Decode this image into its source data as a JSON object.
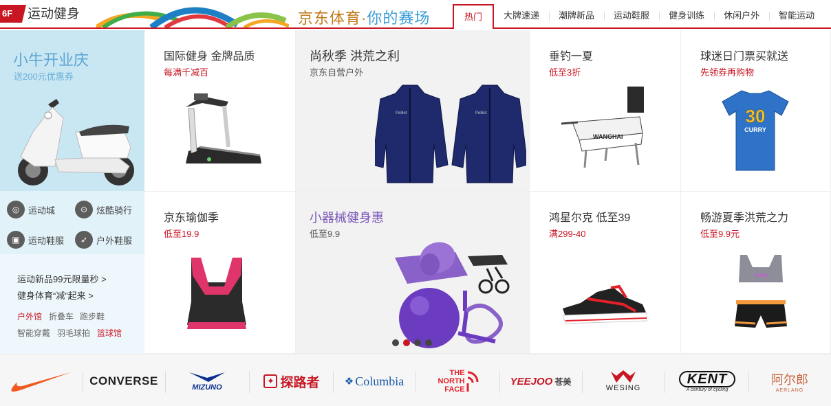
{
  "header": {
    "floor": "6F",
    "title": "运动健身",
    "slogan_a": "京东体育",
    "slogan_dot": "·",
    "slogan_b": "你的赛场",
    "tabs": [
      "热门",
      "大牌速递",
      "潮牌新品",
      "运动鞋服",
      "健身训练",
      "休闲户外",
      "智能运动"
    ],
    "active_tab": 0
  },
  "left": {
    "banner_title": "小牛开业庆",
    "banner_sub": "送200元优惠券",
    "cats": [
      "运动城",
      "炫酷骑行",
      "运动鞋服",
      "户外鞋服"
    ],
    "links": [
      "运动新品99元限量秒 >",
      "健身体育“减”起来 >"
    ],
    "small_links": [
      "户外馆",
      "折叠车",
      "跑步鞋",
      "智能穿戴",
      "羽毛球拍",
      "篮球馆"
    ]
  },
  "cards": [
    {
      "title": "国际健身 金牌品质",
      "sub": "每满千减百"
    },
    {
      "title": "尚秋季 洪荒之利",
      "sub": "京东自营户外"
    },
    {
      "title": "垂钓一夏",
      "sub": "低至3折"
    },
    {
      "title": "球迷日门票买就送",
      "sub": "先领券再购物"
    },
    {
      "title": "京东瑜伽季",
      "sub": "低至19.9"
    },
    {
      "title": "小器械健身惠",
      "sub": "低至9.9"
    },
    {
      "title": "鸿星尔克 低至39",
      "sub": "满299-40"
    },
    {
      "title": "畅游夏季洪荒之力",
      "sub": "低至9.9元"
    }
  ],
  "products": {
    "chair_brand": "WANGHAI",
    "shirt_number": "30",
    "shirt_name": "CURRY",
    "bra_brand": "SANQI",
    "jacket_badge": "Pelliot"
  },
  "carousel": {
    "count": 4,
    "active": 1
  },
  "brands": {
    "converse": "CONVERSE",
    "mizuno": "MIZUNO",
    "toread": "探路者",
    "columbia": "Columbia",
    "tnf_1": "THE",
    "tnf_2": "NORTH",
    "tnf_3": "FACE",
    "yeejoo": "YEEJOO",
    "yeejoo_cn": "苍美",
    "wesing": "WESING",
    "kent": "KENT",
    "kent_sub": "A century of cycling",
    "aerlang": "阿尔郎",
    "aerlang_sub": "AERLANG"
  },
  "colors": {
    "accent": "#c81623",
    "banner_blue": "#5da6d3",
    "purple": "#7a56b8"
  }
}
